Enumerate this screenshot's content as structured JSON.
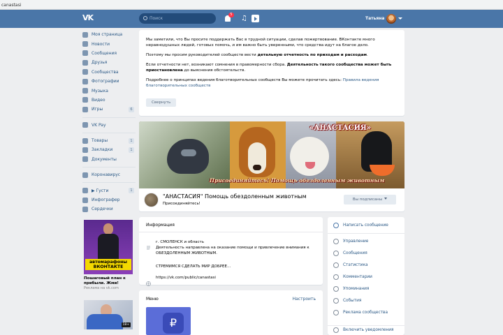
{
  "browser": {
    "url_fragment": "canastasi"
  },
  "header": {
    "search_placeholder": "Поиск",
    "notifications_count": "5",
    "user_name": "Татьяна"
  },
  "nav": {
    "items": [
      {
        "label": "Моя страница",
        "icon": "home-icon"
      },
      {
        "label": "Новости",
        "icon": "news-icon"
      },
      {
        "label": "Сообщения",
        "icon": "messages-icon"
      },
      {
        "label": "Друзья",
        "icon": "friends-icon"
      },
      {
        "label": "Сообщества",
        "icon": "communities-icon"
      },
      {
        "label": "Фотографии",
        "icon": "photo-icon"
      },
      {
        "label": "Музыка",
        "icon": "music-icon"
      },
      {
        "label": "Видео",
        "icon": "video-icon"
      },
      {
        "label": "Игры",
        "icon": "games-icon",
        "count": "6"
      }
    ],
    "vkpay": "VK Pay",
    "group2": [
      {
        "label": "Товары",
        "icon": "goods-icon",
        "count": "1"
      },
      {
        "label": "Закладки",
        "icon": "bookmarks-icon",
        "count": "1"
      },
      {
        "label": "Документы",
        "icon": "documents-icon"
      }
    ],
    "corona": "Коронавирус",
    "group3": [
      {
        "label": "▶ Густи",
        "icon": "apps-icon",
        "count": "1"
      },
      {
        "label": "Инфографер",
        "icon": "infographer-icon"
      },
      {
        "label": "Сердечки",
        "icon": "hearts-icon"
      }
    ]
  },
  "ad": {
    "caption": "автомарафоны ВКОНТАКТЕ",
    "title": "Пошаговый план к прибыли. Жми!",
    "sub": "Реклама на vk.com",
    "tag": "18+"
  },
  "notice": {
    "p1": "Мы заметили, что Вы просите поддержать Вас в трудной ситуации, сделав пожертвование. ВКонтакте много неравнодушных людей, готовых помочь, и им важно быть уверенными, что средства идут на благое дело.",
    "p2_pre": "Поэтому мы просим руководителей сообществ вести ",
    "p2_bold": "детальную отчетность по приходам и расходам",
    "p2_post": ".",
    "p3_pre": "Если отчетности нет, возникают сомнения в правомерности сбора. ",
    "p3_bold": "Деятельность такого сообщества может быть приостановлена",
    "p3_post": " до выяснения обстоятельств.",
    "p4_pre": "Подробнее о принципах ведения благотворительных сообществ Вы можете прочитать здесь: ",
    "p4_link": "Правила ведения благотворительных сообществ",
    "collapse": "Свернуть"
  },
  "cover": {
    "title": "«АНАСТАСИЯ»",
    "slogan": "Присоединяйтесь! Помощь обездоленным животным"
  },
  "group": {
    "name": "\"АНАСТАСИЯ\" Помощь обездоленным животным",
    "sub": "Присоединяйтесь!",
    "subscribed": "Вы подписаны"
  },
  "info": {
    "header": "Информация",
    "city": "г. СМОЛЕНСК и область",
    "desc1": "Деятельность направлена на оказание помощи и привлечение внимания к",
    "desc2": "ОБЕЗДОЛЕННЫМ ЖИВОТНЫМ.",
    "desc3": "СТРЕМИМСЯ СДЕЛАТЬ МИР ДОБРЕЕ...",
    "link": "https://vk.com/public/canastasi"
  },
  "menu": {
    "header": "Меню",
    "edit": "Настроить"
  },
  "side": {
    "items": [
      {
        "label": "Написать сообщение",
        "icon": "message-icon"
      },
      {
        "label": "Управление",
        "icon": "settings-icon"
      },
      {
        "label": "Сообщения",
        "icon": "chat-icon"
      },
      {
        "label": "Статистика",
        "icon": "stats-icon"
      },
      {
        "label": "Комментарии",
        "icon": "comments-icon"
      },
      {
        "label": "Упоминания",
        "icon": "mentions-icon"
      },
      {
        "label": "События",
        "icon": "events-icon"
      },
      {
        "label": "Реклама сообщества",
        "icon": "ads-icon"
      },
      {
        "label": "Включить уведомления",
        "icon": "bell-icon"
      }
    ]
  }
}
